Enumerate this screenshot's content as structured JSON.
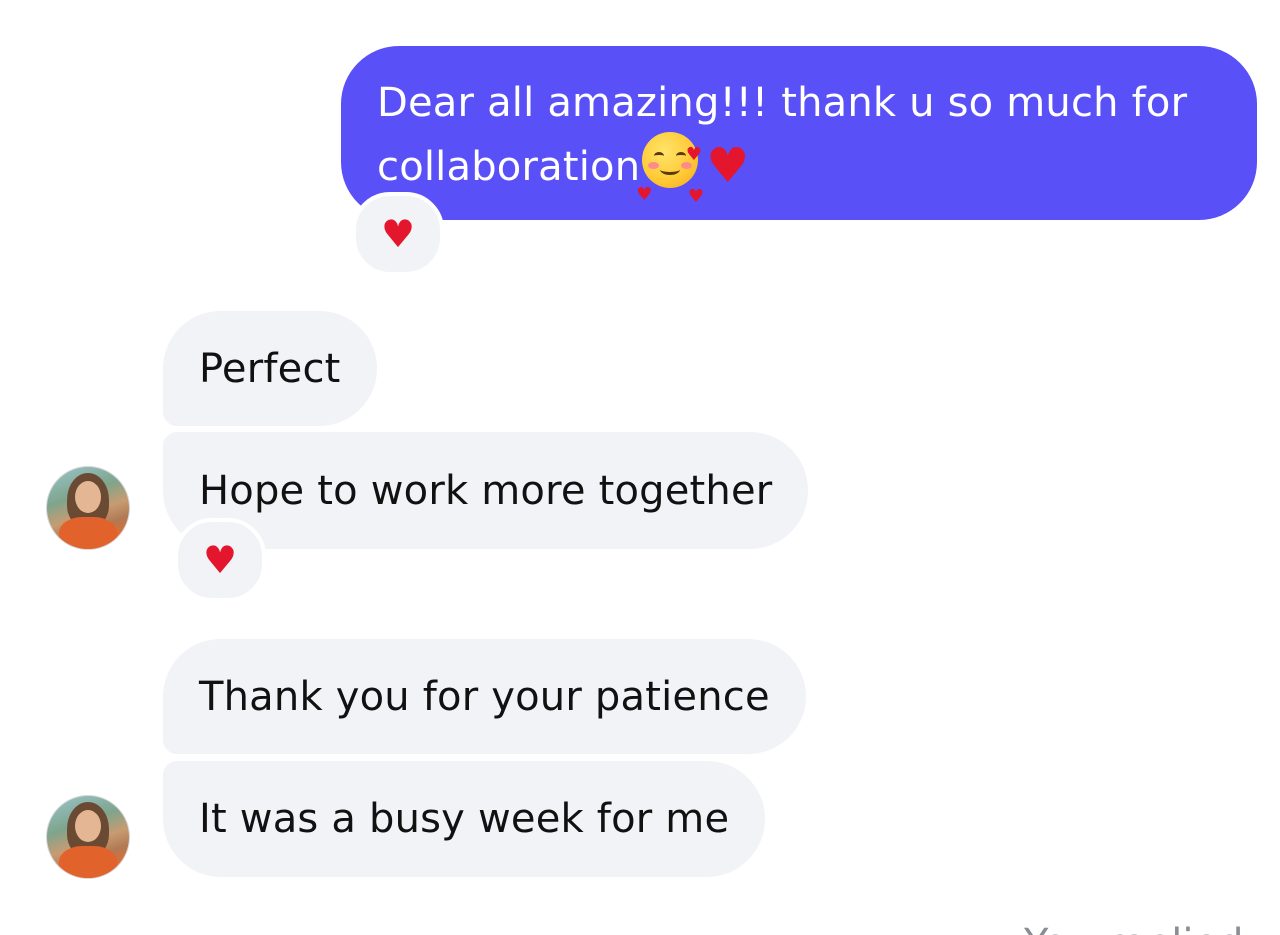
{
  "conversation": {
    "sent_message": {
      "text": "Dear all amazing!!!  thank u so much for collaboration",
      "emojis": [
        "smiling-face-with-hearts-icon",
        "red-heart-icon"
      ],
      "reaction": "red-heart-icon",
      "color": "#5a50f8"
    },
    "received_groups": [
      {
        "messages": [
          {
            "text": "Perfect"
          },
          {
            "text": "Hope to work more together",
            "reaction": "red-heart-icon"
          }
        ],
        "avatar": "contact-avatar"
      },
      {
        "messages": [
          {
            "text": "Thank you for your patience"
          },
          {
            "text": "It was a busy week for me"
          }
        ],
        "avatar": "contact-avatar"
      }
    ],
    "footer_note": "You replied"
  },
  "colors": {
    "sent_bubble": "#5a50f8",
    "received_bubble": "#f2f3f6",
    "heart": "#e3162e",
    "muted_text": "#8a8d94"
  }
}
